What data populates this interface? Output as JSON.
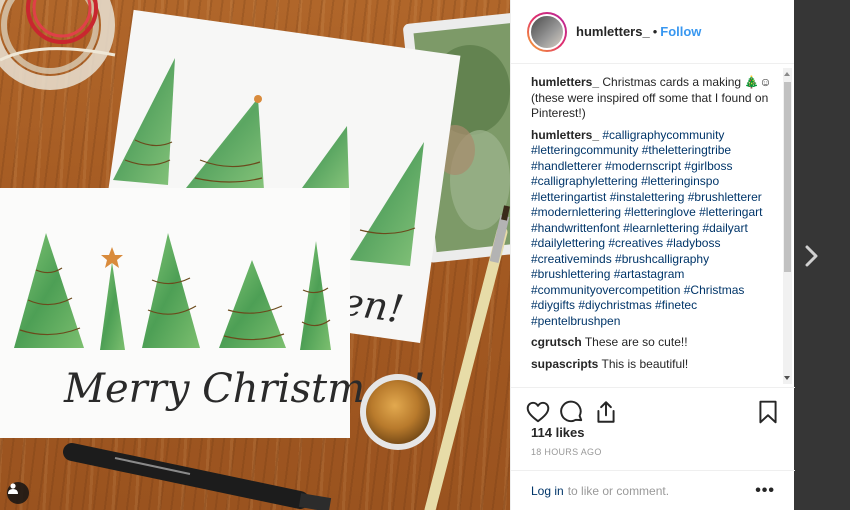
{
  "post": {
    "username": "humletters_",
    "dot": "•",
    "follow_label": "Follow"
  },
  "comments": [
    {
      "author": "humletters_",
      "text": "Christmas cards a making 🎄☺ (these were inspired off some that I found on Pinterest!)",
      "is_tags": false
    },
    {
      "author": "humletters_",
      "text": "#calligraphycommunity #letteringcommunity #theletteringtribe #handletterer #modernscript #girlboss #calligraphylettering #letteringinspo #letteringartist #instalettering #brushletterer #modernlettering #letteringlove #letteringart #handwrittenfont #learnlettering #dailyart #dailylettering #creatives #ladyboss #creativeminds #brushcalligraphy #brushlettering #artastagram #communityovercompetition #Christmas #diygifts #diychristmas #finetec #pentelbrushpen",
      "is_tags": true
    },
    {
      "author": "cgrutsch",
      "text": "These are so cute!!",
      "is_tags": false
    },
    {
      "author": "supascripts",
      "text": "This is beautiful!",
      "is_tags": false
    }
  ],
  "likes_label": "114 likes",
  "timestamp": "18 HOURS AGO",
  "footer": {
    "login_label": "Log in",
    "rest_label": "to like or comment.",
    "more_label": "•••"
  },
  "photo": {
    "card_text": "Merry Christmas!",
    "back_card_text": "en!"
  },
  "icons": {
    "like": "heart-icon",
    "comment": "comment-bubble-icon",
    "share": "share-icon",
    "save": "bookmark-icon",
    "next": "chevron-right-icon",
    "tag": "user-tag-icon"
  },
  "colors": {
    "follow": "#3897f0",
    "hashtag": "#003569",
    "tree_green": "#5fae5a",
    "wood": "#a45a22"
  }
}
